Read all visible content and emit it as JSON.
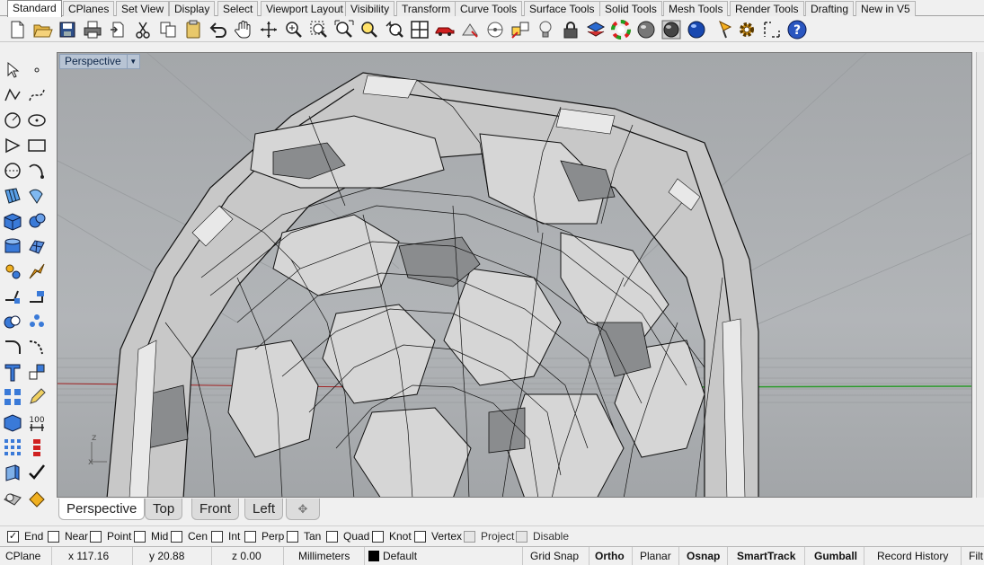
{
  "tabs": [
    {
      "label": "Standard",
      "active": true
    },
    {
      "label": "CPlanes"
    },
    {
      "label": "Set View"
    },
    {
      "label": "Display"
    },
    {
      "label": "Select"
    },
    {
      "label": "Viewport Layout"
    },
    {
      "label": "Visibility"
    },
    {
      "label": "Transform"
    },
    {
      "label": "Curve Tools"
    },
    {
      "label": "Surface Tools"
    },
    {
      "label": "Solid Tools"
    },
    {
      "label": "Mesh Tools"
    },
    {
      "label": "Render Tools"
    },
    {
      "label": "Drafting"
    },
    {
      "label": "New in V5"
    }
  ],
  "toolbar_icons": [
    "new-document-icon",
    "open-folder-icon",
    "save-icon",
    "print-icon",
    "import-icon",
    "cut-icon",
    "copy-icon",
    "paste-icon",
    "undo-icon",
    "pan-hand-icon",
    "rotate-view-icon",
    "zoom-icon",
    "zoom-window-icon",
    "zoom-extents-icon",
    "zoom-selected-icon",
    "undo-view-icon",
    "four-viewports-icon",
    "car-icon",
    "properties-icon",
    "cplane-icon",
    "grid-snap-icon",
    "lightbulb-icon",
    "lock-icon",
    "layer-icon",
    "color-wheel-icon",
    "render-sphere-icon",
    "shaded-sphere-icon",
    "material-sphere-icon",
    "lamp-icon",
    "gear-icon",
    "dimension-icon",
    "help-icon"
  ],
  "left_tools": [
    "select-arrow-icon",
    "point-icon",
    "polyline-icon",
    "curve-icon",
    "circle-icon",
    "ellipse-icon",
    "polygon-icon",
    "rectangle-icon",
    "arc-icon",
    "curve-edit-icon",
    "surface-icon",
    "surface-edit-icon",
    "box-icon",
    "sphere-icon",
    "cylinder-icon",
    "mesh-icon",
    "explode-icon",
    "trim-icon",
    "split-icon",
    "offset-icon",
    "boolean-icon",
    "points-cloud-icon",
    "fillet-icon",
    "blend-curve-icon",
    "text-icon",
    "scale-icon",
    "array-icon",
    "edit-pencil-icon",
    "solid-box-icon",
    "dimension-icon",
    "grid-array-icon",
    "move-icon",
    "cube-icon",
    "check-icon",
    "sphere-group-icon",
    "paint-bucket-icon"
  ],
  "viewport": {
    "title": "Perspective",
    "axis_z": "z",
    "axis_x": "x",
    "bg_color": "#a8abae"
  },
  "view_tabs": [
    "Perspective",
    "Top",
    "Front",
    "Left"
  ],
  "osnap": [
    {
      "label": "End",
      "checked": true
    },
    {
      "label": "Near",
      "checked": false
    },
    {
      "label": "Point",
      "checked": false
    },
    {
      "label": "Mid",
      "checked": false
    },
    {
      "label": "Cen",
      "checked": false
    },
    {
      "label": "Int",
      "checked": false
    },
    {
      "label": "Perp",
      "checked": false
    },
    {
      "label": "Tan",
      "checked": false
    },
    {
      "label": "Quad",
      "checked": false
    },
    {
      "label": "Knot",
      "checked": false
    },
    {
      "label": "Vertex",
      "checked": false
    },
    {
      "label": "Project",
      "checked": false,
      "disabled": true
    },
    {
      "label": "Disable",
      "checked": false,
      "disabled": true
    }
  ],
  "status": {
    "cplane": "CPlane",
    "x": "x 117.16",
    "y": "y 20.88",
    "z": "z 0.00",
    "units": "Millimeters",
    "layer": "Default",
    "grid_snap": "Grid Snap",
    "ortho": "Ortho",
    "planar": "Planar",
    "osnap": "Osnap",
    "smarttrack": "SmartTrack",
    "gumball": "Gumball",
    "record_history": "Record History",
    "filter": "Filt"
  }
}
